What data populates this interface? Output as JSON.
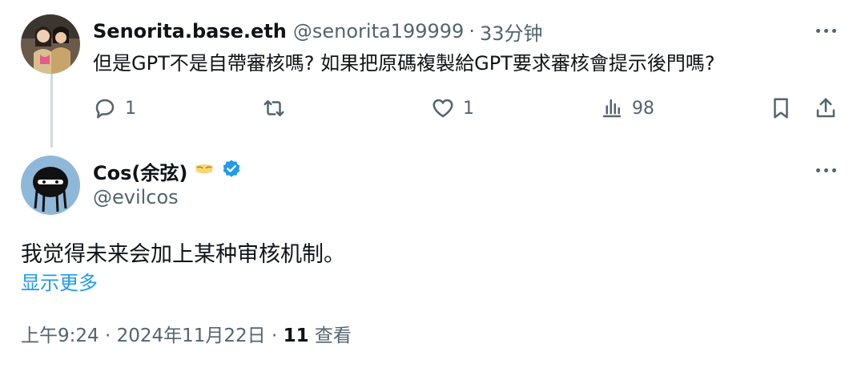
{
  "reply": {
    "author_name": "Senorita.base.eth",
    "author_handle": "@senorita199999",
    "separator": "·",
    "time_ago": "33分钟",
    "text": "但是GPT不是自帶審核嗎? 如果把原碼複製給GPT要求審核會提示後門嗎?",
    "reply_count": "1",
    "like_count": "1",
    "view_count": "98"
  },
  "tweet": {
    "author_name": "Cos(余弦)",
    "author_handle": "@evilcos",
    "text": "我觉得未来会加上某种审核机制。",
    "show_more": "显示更多",
    "timestamp": "上午9:24 · 2024年11月22日 ·",
    "views_count": "11",
    "views_label": "查看"
  },
  "colors": {
    "text": "#0f1419",
    "muted": "#536471",
    "link": "#1d9bf0",
    "verified": "#1d9bf0",
    "thread_line": "#cfd9de"
  },
  "icons": [
    "more-icon",
    "reply-icon",
    "retweet-icon",
    "like-icon",
    "views-icon",
    "bookmark-icon",
    "share-icon",
    "verified-badge-icon",
    "mask-emoji-icon"
  ]
}
